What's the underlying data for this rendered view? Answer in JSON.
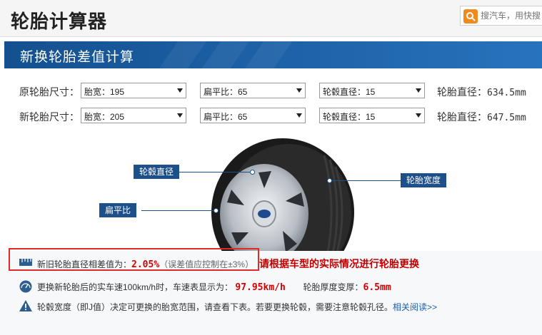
{
  "header": {
    "title": "轮胎计算器",
    "search_placeholder": "搜汽车，用快搜"
  },
  "banner": {
    "title": "新换轮胎差值计算"
  },
  "original_tire": {
    "label": "原轮胎尺寸：",
    "width": "胎宽：195",
    "aspect": "扁平比：65",
    "rim": "轮毂直径：15",
    "diameter_label": "轮胎直径：",
    "diameter_value": "634.5mm"
  },
  "new_tire": {
    "label": "新轮胎尺寸：",
    "width": "胎宽：205",
    "aspect": "扁平比：65",
    "rim": "轮毂直径：15",
    "diameter_label": "轮胎直径：",
    "diameter_value": "647.5mm"
  },
  "diagram": {
    "rim_label": "轮毂直径",
    "aspect_label": "扁平比",
    "width_label": "轮胎宽度"
  },
  "results": {
    "diff_label": "新旧轮胎直径相差值为：",
    "diff_value": "2.05%",
    "diff_note": "（误差值应控制在±3%）",
    "warning": "请根据车型的实际情况进行轮胎更换",
    "speed_label": "更换新轮胎后的实车速100km/h时，车速表显示为：",
    "speed_value": "97.95km/h",
    "thickness_label": "轮胎厚度变厚：",
    "thickness_value": "6.5mm",
    "tip_text": "轮毂宽度（即J值）决定可更换的胎宽范围，请查看下表。若要更换轮毂，需要注意轮毂孔径。",
    "tip_link": "相关阅读>>"
  },
  "colors": {
    "banner_blue": "#1b5ea3",
    "callout_blue": "#1d4f8a",
    "highlight_red": "#d40000",
    "box_red": "#e02a2a",
    "search_orange": "#f08a1c"
  }
}
